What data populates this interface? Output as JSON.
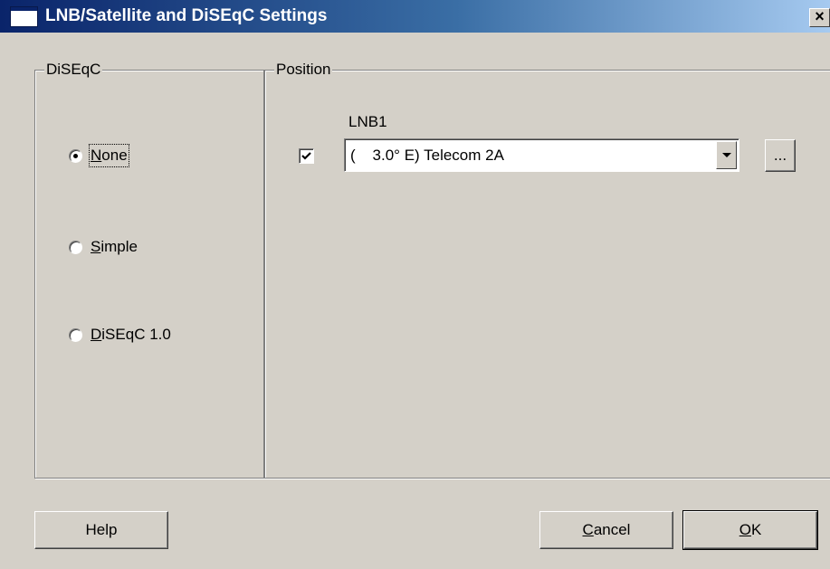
{
  "window": {
    "title": "LNB/Satellite and DiSEqC Settings",
    "close_glyph": "×",
    "icon": "window-app-icon"
  },
  "diseqc_group": {
    "title": "DiSEqC",
    "options": [
      {
        "accel": "N",
        "rest": "one",
        "selected": true
      },
      {
        "accel": "S",
        "rest": "imple",
        "selected": false
      },
      {
        "accel": "D",
        "rest": "iSEqC 1.0",
        "selected": false
      }
    ]
  },
  "position_group": {
    "title": "Position",
    "lnb_label": "LNB1",
    "lnb_enabled": true,
    "satellite_value": "(    3.0° E) Telecom 2A",
    "browse_label": "..."
  },
  "buttons": {
    "help": "Help",
    "cancel_accel": "C",
    "cancel_rest": "ancel",
    "ok_accel": "O",
    "ok_rest": "K"
  },
  "colors": {
    "face": "#d4d0c8",
    "title_gradient_start": "#0a246a",
    "title_gradient_end": "#a6caf0"
  }
}
